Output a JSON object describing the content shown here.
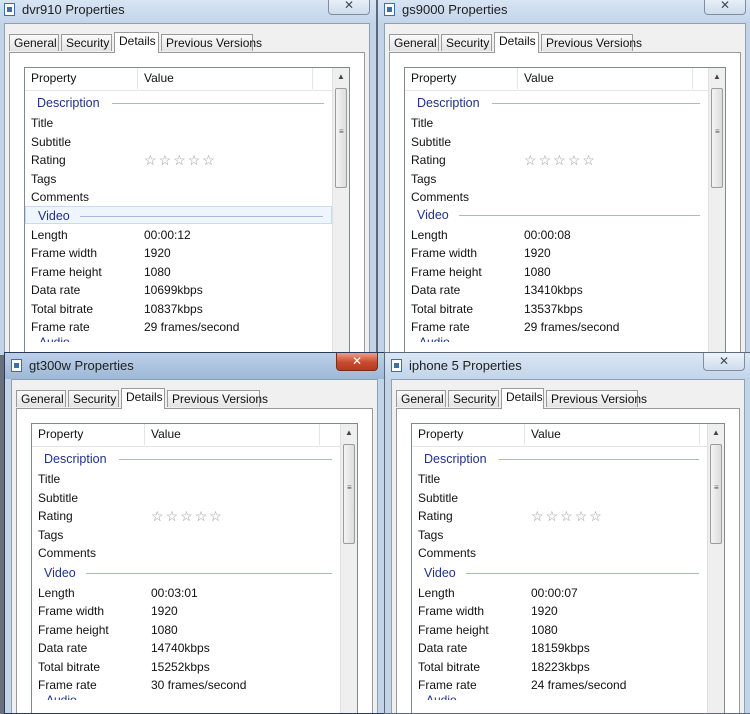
{
  "tab_labels": [
    "General",
    "Security",
    "Details",
    "Previous Versions"
  ],
  "header": {
    "property": "Property",
    "value": "Value"
  },
  "description_rows": [
    "Title",
    "Subtitle",
    "Rating",
    "Tags",
    "Comments"
  ],
  "video_labels": [
    "Length",
    "Frame width",
    "Frame height",
    "Data rate",
    "Total bitrate",
    "Frame rate"
  ],
  "icons": {
    "close": "close-icon",
    "file": "file-icon",
    "star": "star-icon",
    "scroll_up": "scroll-up-arrow-icon"
  },
  "colors": {
    "section": "#1e3287",
    "active_close": "#c74a2e"
  },
  "windows": [
    {
      "id": "dvr910",
      "title": "dvr910 Properties",
      "close_label": "✕",
      "selected_tab": "Details",
      "description_section": "Description",
      "video_section": "Video",
      "audio_section_partial": "Audio",
      "rating_stars": 0,
      "video": [
        "00:00:12",
        "1920",
        "1080",
        "10699kbps",
        "10837kbps",
        "29 frames/second"
      ]
    },
    {
      "id": "gs9000",
      "title": "gs9000 Properties",
      "close_label": "✕",
      "selected_tab": "Details",
      "description_section": "Description",
      "video_section": "Video",
      "audio_section_partial": "Audio",
      "rating_stars": 0,
      "video": [
        "00:00:08",
        "1920",
        "1080",
        "13410kbps",
        "13537kbps",
        "29 frames/second"
      ]
    },
    {
      "id": "gt300w",
      "title": "gt300w Properties",
      "close_label": "✕",
      "selected_tab": "Details",
      "description_section": "Description",
      "video_section": "Video",
      "audio_section_partial": "Audio",
      "rating_stars": 0,
      "video": [
        "00:03:01",
        "1920",
        "1080",
        "14740kbps",
        "15252kbps",
        "30 frames/second"
      ]
    },
    {
      "id": "iphone5",
      "title": "iphone 5 Properties",
      "close_label": "✕",
      "selected_tab": "Details",
      "description_section": "Description",
      "video_section": "Video",
      "audio_section_partial": "Audio",
      "rating_stars": 0,
      "video": [
        "00:00:07",
        "1920",
        "1080",
        "18159kbps",
        "18223kbps",
        "24 frames/second"
      ]
    }
  ]
}
